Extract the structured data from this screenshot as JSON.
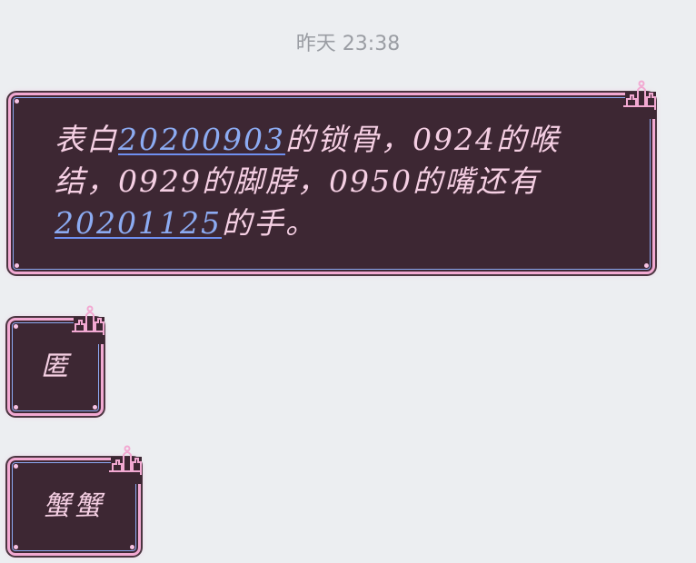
{
  "timestamp": "昨天 23:38",
  "messages": [
    {
      "segments": [
        {
          "text": "表白",
          "link": false
        },
        {
          "text": "20200903",
          "link": true
        },
        {
          "text": "的锁骨，0924的喉结，0929的脚脖，0950的嘴还有",
          "link": false
        },
        {
          "text": "20201125",
          "link": true
        },
        {
          "text": "的手。",
          "link": false
        }
      ]
    },
    {
      "text": "匿"
    },
    {
      "text": "蟹蟹"
    }
  ],
  "colors": {
    "background": "#eceef1",
    "bubble_fill": "#3d2733",
    "bubble_border": "#f2a9d2",
    "bubble_inner_border": "#8ca9f2",
    "text": "#f5cfe3",
    "link": "#8cabf2"
  },
  "icons": {
    "bubble_decoration": "castle-icon"
  }
}
